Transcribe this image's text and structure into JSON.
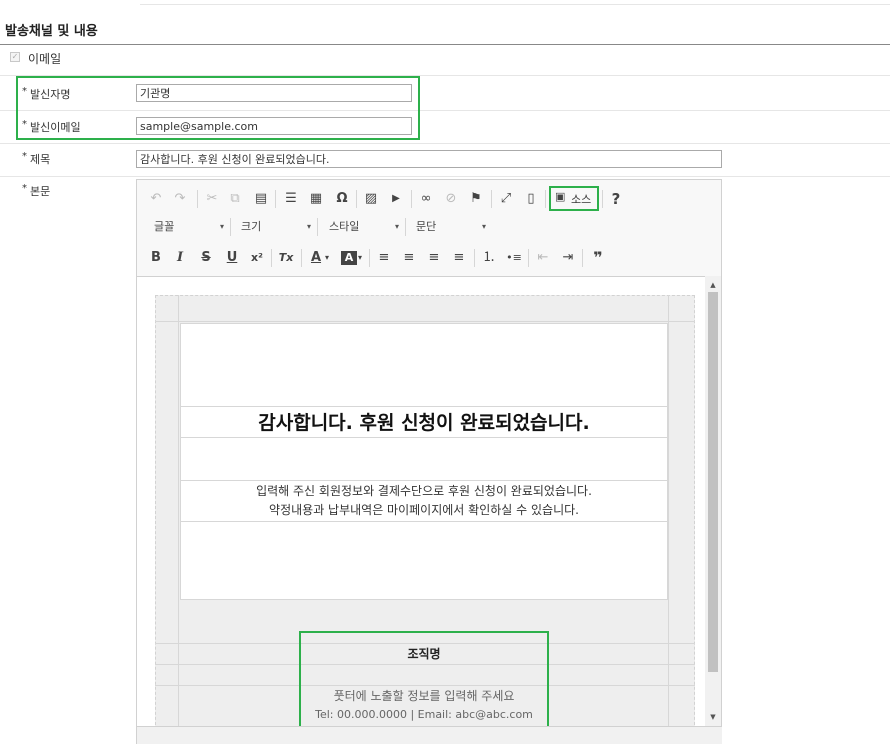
{
  "section": {
    "title": "발송채널 및 내용"
  },
  "channel": {
    "email_label": "이메일",
    "check_mark": "✓"
  },
  "fields": {
    "required_mark": "*",
    "sender_name_label": "발신자명",
    "sender_name_value": "기관명",
    "sender_email_label": "발신이메일",
    "sender_email_value": "sample@sample.com",
    "subject_label": "제목",
    "subject_value": "감사합니다. 후원 신청이 완료되었습니다.",
    "body_label": "본문"
  },
  "toolbar": {
    "row1": {
      "undo": "↶",
      "redo": "↷",
      "cut": "✂",
      "copy": "⧉",
      "paste": "▤",
      "hr": "☰",
      "table": "▦",
      "special_char": "Ω",
      "image": "▨",
      "video": "▶",
      "link": "∞",
      "unlink": "⊘",
      "anchor": "⚑",
      "maximize": "⤢",
      "blocks": "▯",
      "source_label": "소스",
      "source_icon": "▣",
      "help": "?"
    },
    "combos": {
      "font": "글꼴",
      "size": "크기",
      "style": "스타일",
      "format": "문단",
      "arrow": "▾"
    },
    "row2": {
      "bold": "B",
      "italic": "I",
      "strike": "S",
      "underline": "U",
      "superscript": "x²",
      "remove_format": "Tx",
      "text_color": "A",
      "bg_color": "A",
      "align_left": "≡",
      "align_center": "≡",
      "align_right": "≡",
      "justify": "≡",
      "numbered_list": "⒈",
      "bulleted_list": "•≡",
      "outdent": "⇤",
      "indent": "⇥",
      "blockquote": "❞",
      "dropdown_arrow": "▾"
    }
  },
  "content": {
    "headline": "감사합니다. 후원 신청이 완료되었습니다.",
    "message_line1": "입력해 주신 회원정보와 결제수단으로 후원 신청이 완료되었습니다.",
    "message_line2": "약정내용과 납부내역은 마이페이지에서 확인하실 수 있습니다.",
    "org_name": "조직명",
    "footer_hint": "풋터에 노출할 정보를 입력해 주세요",
    "footer_contact": "Tel: 00.000.0000 | Email: abc@abc.com"
  },
  "scrollbar": {
    "up": "▲",
    "down": "▼"
  },
  "colors": {
    "highlight": "#2db04b",
    "border": "#d1d1d1",
    "text": "#333333"
  }
}
